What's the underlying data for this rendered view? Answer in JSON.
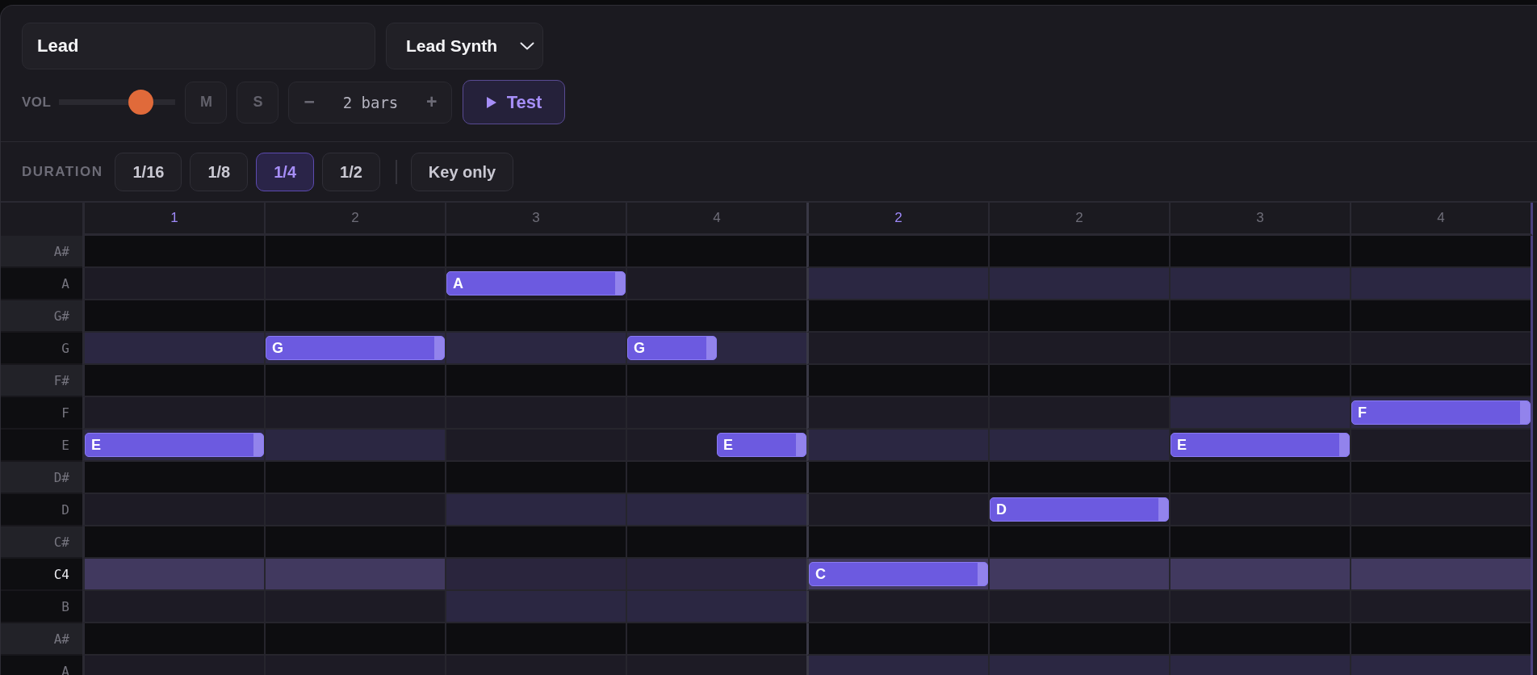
{
  "track": {
    "name": "Lead",
    "instrument": "Lead Synth"
  },
  "mixer": {
    "volume_label": "VOL",
    "level": 0.7,
    "mute": {
      "label": "M",
      "on": false
    },
    "solo": {
      "label": "S",
      "on": false
    }
  },
  "length": {
    "decrement": "−",
    "value": "2 bars",
    "increment": "+"
  },
  "test_button": {
    "label": "Test"
  },
  "duration": {
    "label": "DURATION",
    "options": [
      {
        "label": "1/16",
        "selected": false
      },
      {
        "label": "1/8",
        "selected": false
      },
      {
        "label": "1/4",
        "selected": true
      },
      {
        "label": "1/2",
        "selected": false
      }
    ],
    "key_only": {
      "label": "Key only",
      "on": false
    }
  },
  "piano_roll": {
    "beats": [
      {
        "label": "1",
        "bar_start": true
      },
      {
        "label": "2",
        "bar_start": false
      },
      {
        "label": "3",
        "bar_start": false
      },
      {
        "label": "4",
        "bar_start": false
      },
      {
        "label": "2",
        "bar_start": true
      },
      {
        "label": "2",
        "bar_start": false
      },
      {
        "label": "3",
        "bar_start": false
      },
      {
        "label": "4",
        "bar_start": false
      }
    ],
    "rows": [
      {
        "note": "A#",
        "black_key": true,
        "highlighted": false,
        "cells": [
          {
            "lit": false
          },
          {
            "lit": false
          },
          {
            "lit": false
          },
          {
            "lit": false
          },
          {
            "lit": false
          },
          {
            "lit": false
          },
          {
            "lit": false
          },
          {
            "lit": false
          }
        ]
      },
      {
        "note": "A",
        "black_key": false,
        "highlighted": false,
        "cells": [
          {
            "lit": false
          },
          {
            "lit": false
          },
          {
            "lit": false,
            "note": {
              "label": "A",
              "kind": "full"
            }
          },
          {
            "lit": false
          },
          {
            "lit": true
          },
          {
            "lit": true
          },
          {
            "lit": true
          },
          {
            "lit": true
          }
        ]
      },
      {
        "note": "G#",
        "black_key": true,
        "highlighted": false,
        "cells": [
          {
            "lit": false
          },
          {
            "lit": false
          },
          {
            "lit": false
          },
          {
            "lit": false
          },
          {
            "lit": false
          },
          {
            "lit": false
          },
          {
            "lit": false
          },
          {
            "lit": false
          }
        ]
      },
      {
        "note": "G",
        "black_key": false,
        "highlighted": false,
        "cells": [
          {
            "lit": true
          },
          {
            "lit": true,
            "note": {
              "label": "G",
              "kind": "full"
            }
          },
          {
            "lit": true
          },
          {
            "lit": true,
            "note": {
              "label": "G",
              "kind": "early"
            }
          },
          {
            "lit": false
          },
          {
            "lit": false
          },
          {
            "lit": false
          },
          {
            "lit": false
          }
        ]
      },
      {
        "note": "F#",
        "black_key": true,
        "highlighted": false,
        "cells": [
          {
            "lit": false
          },
          {
            "lit": false
          },
          {
            "lit": false
          },
          {
            "lit": false
          },
          {
            "lit": false
          },
          {
            "lit": false
          },
          {
            "lit": false
          },
          {
            "lit": false
          }
        ]
      },
      {
        "note": "F",
        "black_key": false,
        "highlighted": false,
        "cells": [
          {
            "lit": false
          },
          {
            "lit": false
          },
          {
            "lit": false
          },
          {
            "lit": false
          },
          {
            "lit": false
          },
          {
            "lit": false
          },
          {
            "lit": true
          },
          {
            "lit": true,
            "note": {
              "label": "F",
              "kind": "full"
            }
          }
        ]
      },
      {
        "note": "E",
        "black_key": false,
        "highlighted": false,
        "cells": [
          {
            "lit": true,
            "note": {
              "label": "E",
              "kind": "full"
            }
          },
          {
            "lit": true
          },
          {
            "lit": false
          },
          {
            "lit": false,
            "note": {
              "label": "E",
              "kind": "late"
            }
          },
          {
            "lit": true
          },
          {
            "lit": true
          },
          {
            "lit": false,
            "note": {
              "label": "E",
              "kind": "full"
            }
          },
          {
            "lit": false
          }
        ]
      },
      {
        "note": "D#",
        "black_key": true,
        "highlighted": false,
        "cells": [
          {
            "lit": false
          },
          {
            "lit": false
          },
          {
            "lit": false
          },
          {
            "lit": false
          },
          {
            "lit": false
          },
          {
            "lit": false
          },
          {
            "lit": false
          },
          {
            "lit": false
          }
        ]
      },
      {
        "note": "D",
        "black_key": false,
        "highlighted": false,
        "cells": [
          {
            "lit": false
          },
          {
            "lit": false
          },
          {
            "lit": true
          },
          {
            "lit": true
          },
          {
            "lit": false
          },
          {
            "lit": false,
            "note": {
              "label": "D",
              "kind": "full"
            }
          },
          {
            "lit": false
          },
          {
            "lit": false
          }
        ]
      },
      {
        "note": "C#",
        "black_key": true,
        "highlighted": false,
        "cells": [
          {
            "lit": false
          },
          {
            "lit": false
          },
          {
            "lit": false
          },
          {
            "lit": false
          },
          {
            "lit": false
          },
          {
            "lit": false
          },
          {
            "lit": false
          },
          {
            "lit": false
          }
        ]
      },
      {
        "note": "C4",
        "black_key": false,
        "highlighted": true,
        "cells": [
          {
            "lit": true
          },
          {
            "lit": true
          },
          {
            "lit": false
          },
          {
            "lit": false
          },
          {
            "lit": true,
            "note": {
              "label": "C",
              "kind": "full"
            }
          },
          {
            "lit": true
          },
          {
            "lit": true
          },
          {
            "lit": true
          }
        ]
      },
      {
        "note": "B",
        "black_key": false,
        "highlighted": false,
        "cells": [
          {
            "lit": false
          },
          {
            "lit": false
          },
          {
            "lit": true
          },
          {
            "lit": true
          },
          {
            "lit": false
          },
          {
            "lit": false
          },
          {
            "lit": false
          },
          {
            "lit": false
          }
        ]
      },
      {
        "note": "A#",
        "black_key": true,
        "highlighted": false,
        "cells": [
          {
            "lit": false
          },
          {
            "lit": false
          },
          {
            "lit": false
          },
          {
            "lit": false
          },
          {
            "lit": false
          },
          {
            "lit": false
          },
          {
            "lit": false
          },
          {
            "lit": false
          }
        ]
      },
      {
        "note": "A",
        "black_key": false,
        "highlighted": false,
        "cells": [
          {
            "lit": false
          },
          {
            "lit": false
          },
          {
            "lit": false
          },
          {
            "lit": false
          },
          {
            "lit": true
          },
          {
            "lit": true
          },
          {
            "lit": true
          },
          {
            "lit": true
          }
        ]
      }
    ]
  }
}
